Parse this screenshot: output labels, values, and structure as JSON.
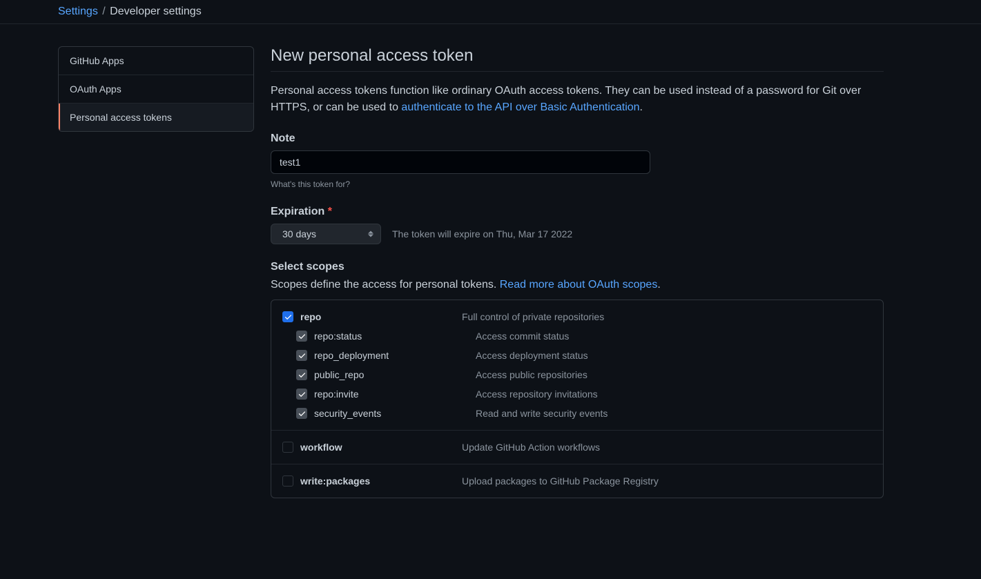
{
  "breadcrumb": {
    "root": "Settings",
    "current": "Developer settings"
  },
  "sidebar": {
    "items": [
      {
        "label": "GitHub Apps"
      },
      {
        "label": "OAuth Apps"
      },
      {
        "label": "Personal access tokens"
      }
    ]
  },
  "page": {
    "title": "New personal access token",
    "intro_pre": "Personal access tokens function like ordinary OAuth access tokens. They can be used instead of a password for Git over HTTPS, or can be used to ",
    "intro_link": "authenticate to the API over Basic Authentication",
    "intro_post": "."
  },
  "note": {
    "label": "Note",
    "value": "test1",
    "hint": "What's this token for?"
  },
  "expiration": {
    "label": "Expiration",
    "value": "30 days",
    "note": "The token will expire on Thu, Mar 17 2022"
  },
  "scopes": {
    "title": "Select scopes",
    "desc_pre": "Scopes define the access for personal tokens. ",
    "desc_link": "Read more about OAuth scopes",
    "desc_post": ".",
    "groups": [
      {
        "name": "repo",
        "desc": "Full control of private repositories",
        "checked": true,
        "children": [
          {
            "name": "repo:status",
            "desc": "Access commit status",
            "checked": true
          },
          {
            "name": "repo_deployment",
            "desc": "Access deployment status",
            "checked": true
          },
          {
            "name": "public_repo",
            "desc": "Access public repositories",
            "checked": true
          },
          {
            "name": "repo:invite",
            "desc": "Access repository invitations",
            "checked": true
          },
          {
            "name": "security_events",
            "desc": "Read and write security events",
            "checked": true
          }
        ]
      },
      {
        "name": "workflow",
        "desc": "Update GitHub Action workflows",
        "checked": false,
        "children": []
      },
      {
        "name": "write:packages",
        "desc": "Upload packages to GitHub Package Registry",
        "checked": false,
        "children": []
      }
    ]
  }
}
